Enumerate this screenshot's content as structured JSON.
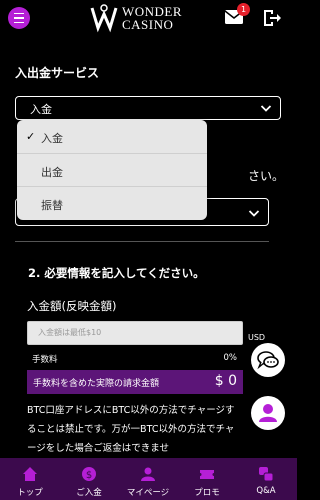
{
  "header": {
    "logo_line1": "WONDER",
    "logo_line2": "CASINO",
    "mail_badge": "1"
  },
  "section_title": "入出金サービス",
  "service_select": {
    "value": "入金"
  },
  "dropdown": {
    "options": [
      {
        "label": "入金",
        "selected": true,
        "check": "✓"
      },
      {
        "label": "出金",
        "selected": false
      },
      {
        "label": "振替",
        "selected": false
      }
    ]
  },
  "partial_text": "さい。",
  "step2_title": "2. 必要情報を記入してください。",
  "amount": {
    "label": "入金額(反映金額)",
    "placeholder": "入金額は最低$10",
    "unit": "USD"
  },
  "fee": {
    "label": "手数料",
    "value": "0%"
  },
  "total": {
    "label": "手数料を含めた実際の請求金額",
    "value": "$ 0"
  },
  "notice": "BTC口座アドレスにBTC以外の方法でチャージすることは禁止です。万が一BTC以外の方法でチャージをした場合ご返金はできませ",
  "bottom_nav": [
    {
      "label": "トップ",
      "icon": "home-icon"
    },
    {
      "label": "ご入金",
      "icon": "dollar-icon"
    },
    {
      "label": "マイページ",
      "icon": "user-icon"
    },
    {
      "label": "プロモ",
      "icon": "ticket-icon"
    },
    {
      "label": "Q&A",
      "icon": "qa-icon"
    }
  ],
  "colors": {
    "accent": "#b51fd6",
    "nav_bg": "#3c0a4d",
    "total_bg": "#5c1578",
    "badge": "#e5202b"
  }
}
